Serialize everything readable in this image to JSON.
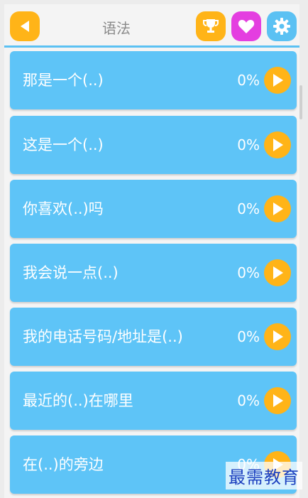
{
  "header": {
    "title": "语法",
    "back_icon": "triangle-left-icon",
    "trophy_icon": "trophy-icon",
    "heart_icon": "heart-icon",
    "settings_icon": "gear-icon"
  },
  "colors": {
    "accent_blue": "#5ec4f7",
    "orange": "#ffb418",
    "magenta": "#e43ee0",
    "watermark_blue": "#1c3fbf"
  },
  "lessons": [
    {
      "label": "那是一个(..)",
      "progress": "0%"
    },
    {
      "label": "这是一个(..)",
      "progress": "0%"
    },
    {
      "label": "你喜欢(..)吗",
      "progress": "0%"
    },
    {
      "label": "我会说一点(..)",
      "progress": "0%"
    },
    {
      "label": "我的电话号码/地址是(..)",
      "progress": "0%"
    },
    {
      "label": "最近的(..)在哪里",
      "progress": "0%"
    },
    {
      "label": "在(..)的旁边",
      "progress": "0%"
    }
  ],
  "watermark": "最需教育"
}
